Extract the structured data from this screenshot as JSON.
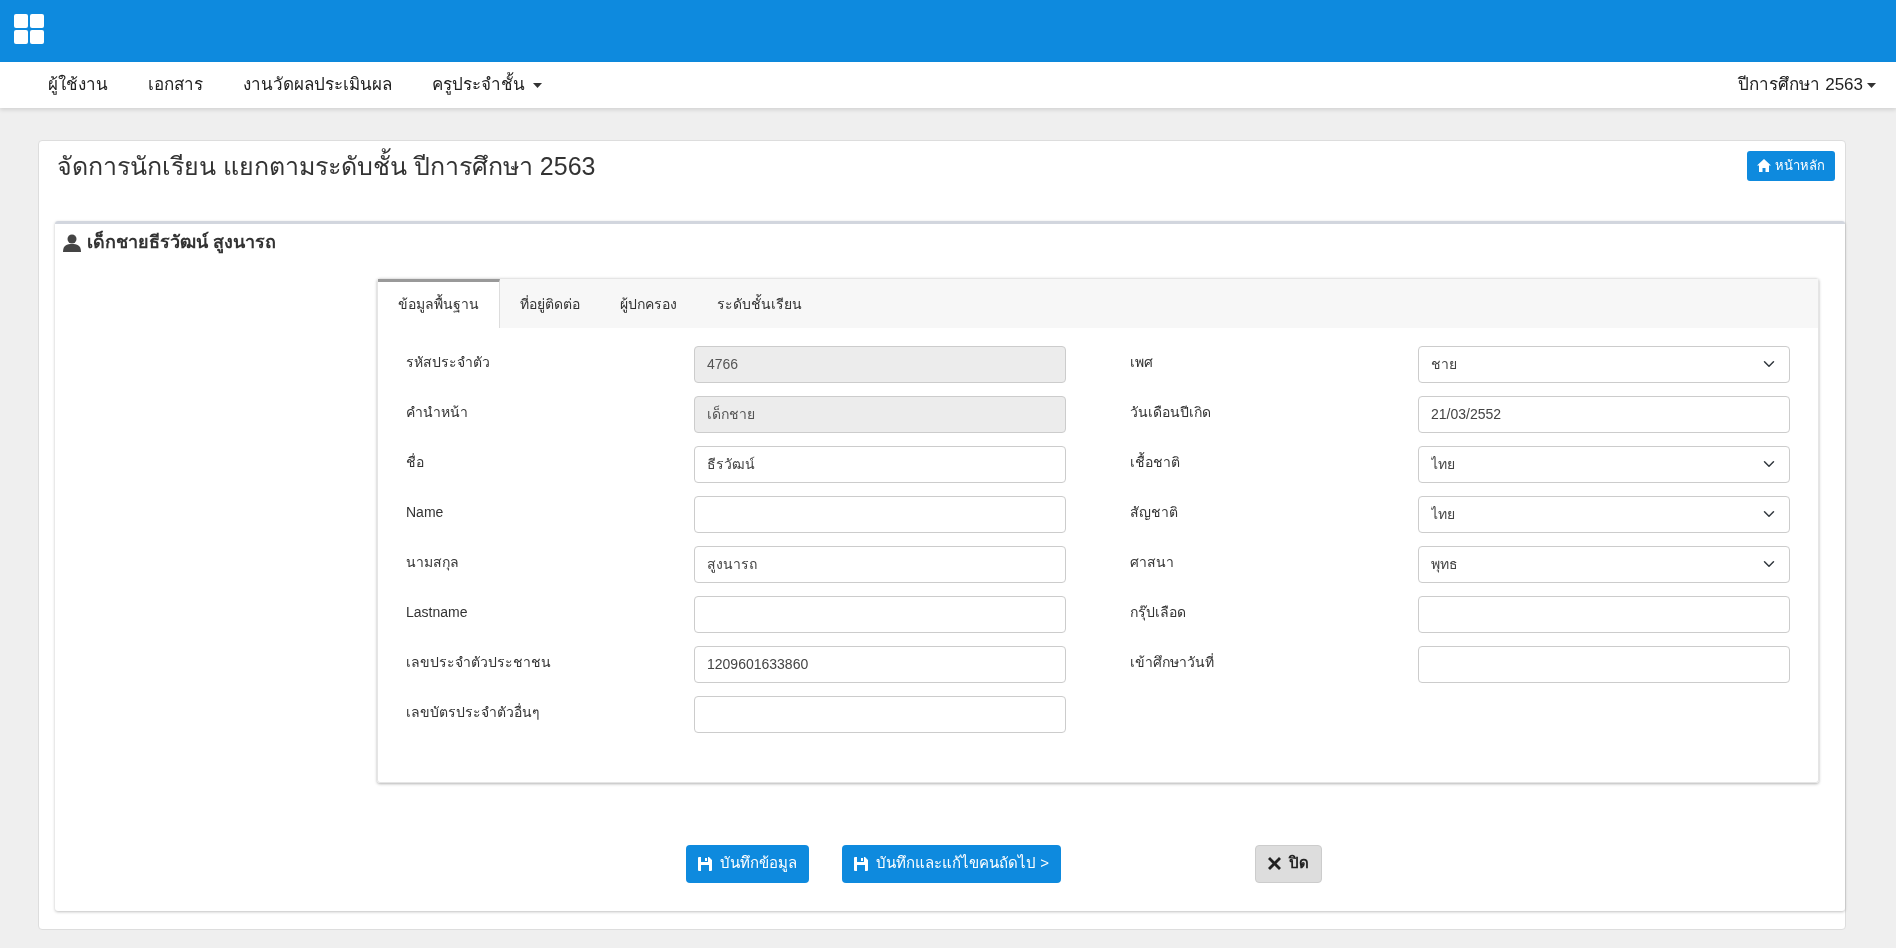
{
  "topbar": {
    "menu": [
      {
        "label": "ผู้ใช้งาน",
        "dropdown": false
      },
      {
        "label": "เอกสาร",
        "dropdown": false
      },
      {
        "label": "งานวัดผลประเมินผล",
        "dropdown": false
      },
      {
        "label": "ครูประจำชั้น",
        "dropdown": true
      }
    ],
    "year_menu": {
      "label": "ปีการศึกษา 2563",
      "dropdown": true
    }
  },
  "page": {
    "title": "จัดการนักเรียน แยกตามระดับชั้น ปีการศึกษา 2563",
    "home_button": "หน้าหลัก"
  },
  "student": {
    "name": "เด็กชายธีรวัฒน์ สูงนารถ"
  },
  "tabs": [
    {
      "label": "ข้อมูลพื้นฐาน",
      "selected": true
    },
    {
      "label": "ที่อยู่ติดต่อ",
      "selected": false
    },
    {
      "label": "ผู้ปกครอง",
      "selected": false
    },
    {
      "label": "ระดับชั้นเรียน",
      "selected": false
    }
  ],
  "left_fields": [
    {
      "label": "รหัสประจำตัว",
      "value": "4766",
      "readonly": true
    },
    {
      "label": "คำนำหน้า",
      "value": "เด็กชาย",
      "readonly": true
    },
    {
      "label": "ชื่อ",
      "value": "ธีรวัฒน์",
      "readonly": false
    },
    {
      "label": "Name",
      "readonly": false
    },
    {
      "label": "นามสกุล",
      "value": "สูงนารถ",
      "readonly": false
    },
    {
      "label": "Lastname",
      "readonly": false
    },
    {
      "label": "เลขประจำตัวประชาชน",
      "value": "1209601633860",
      "readonly": false
    },
    {
      "label": "เลขบัตรประจำตัวอื่นๆ",
      "readonly": false
    }
  ],
  "right_fields": [
    {
      "label": "เพศ",
      "kind": "select",
      "value": "ชาย"
    },
    {
      "label": "วันเดือนปีเกิด",
      "kind": "text",
      "value": "21/03/2552"
    },
    {
      "label": "เชื้อชาติ",
      "kind": "select",
      "value": "ไทย"
    },
    {
      "label": "สัญชาติ",
      "kind": "select",
      "value": "ไทย"
    },
    {
      "label": "ศาสนา",
      "kind": "select",
      "value": "พุทธ"
    },
    {
      "label": "กรุ๊ปเลือด",
      "kind": "text"
    },
    {
      "label": "เข้าศึกษาวันที่",
      "kind": "text"
    }
  ],
  "buttons": [
    {
      "label": "บันทึกข้อมูล",
      "kind": "save"
    },
    {
      "label": "บันทึกและแก้ไขคนถัดไป >",
      "kind": "save"
    },
    {
      "label": "ปิด",
      "kind": "close"
    }
  ]
}
